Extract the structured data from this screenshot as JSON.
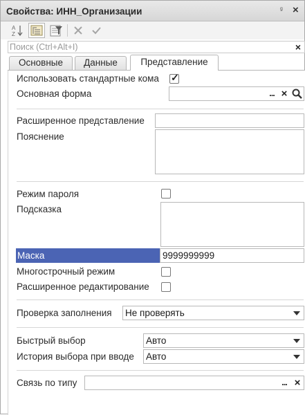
{
  "window": {
    "title": "Свойства: ИНН_Организации",
    "pin_glyph": "ᵍ",
    "close_glyph": "×"
  },
  "toolbar": {
    "buttons": [
      {
        "icon": "sort-az-icon"
      },
      {
        "icon": "categories-icon"
      },
      {
        "icon": "filter-icon"
      },
      {
        "icon": "clear-icon"
      },
      {
        "icon": "confirm-icon"
      }
    ]
  },
  "search": {
    "placeholder": "Поиск (Ctrl+Alt+I)",
    "value": "",
    "clear_glyph": "×"
  },
  "tabs": [
    {
      "label": "Основные",
      "selected": false
    },
    {
      "label": "Данные",
      "selected": false
    },
    {
      "label": "Представление",
      "selected": true
    }
  ],
  "props": {
    "use_std_commands": {
      "label": "Использовать стандартные кома",
      "checked": true,
      "mark": "✓"
    },
    "main_form": {
      "label": "Основная форма",
      "value": ""
    },
    "ext_presentation": {
      "label": "Расширенное представление",
      "value": ""
    },
    "explanation": {
      "label": "Пояснение",
      "value": ""
    },
    "password_mode": {
      "label": "Режим пароля",
      "checked": false
    },
    "tooltip": {
      "label": "Подсказка",
      "value": ""
    },
    "mask": {
      "label": "Маска",
      "value": "9999999999"
    },
    "multiline": {
      "label": "Многострочный режим",
      "checked": false
    },
    "ext_edit": {
      "label": "Расширенное редактирование",
      "checked": false
    },
    "fill_check": {
      "label": "Проверка заполнения",
      "value": "Не проверять"
    },
    "quick_choice": {
      "label": "Быстрый выбор",
      "value": "Авто"
    },
    "choice_history": {
      "label": "История выбора при вводе",
      "value": "Авто"
    },
    "type_link": {
      "label": "Связь по типу",
      "value": ""
    }
  },
  "glyphs": {
    "dots": "...",
    "x": "×"
  },
  "colors": {
    "selection": "#4b64b4",
    "title_bg": "#e0e0e0"
  }
}
